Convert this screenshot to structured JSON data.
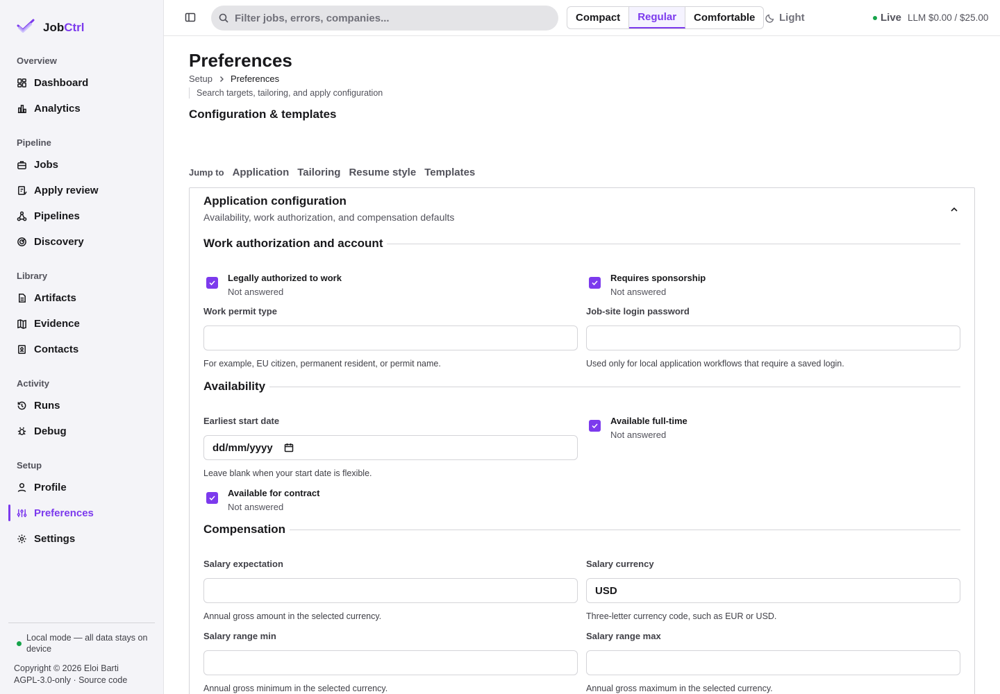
{
  "brand": {
    "name_prefix": "Job",
    "name_accent": "Ctrl"
  },
  "sidebar": {
    "sections": [
      {
        "title": "Overview",
        "items": [
          {
            "label": "Dashboard",
            "icon": "grid-icon"
          },
          {
            "label": "Analytics",
            "icon": "bar-chart-icon"
          }
        ]
      },
      {
        "title": "Pipeline",
        "items": [
          {
            "label": "Jobs",
            "icon": "briefcase-icon"
          },
          {
            "label": "Apply review",
            "icon": "clipboard-icon"
          },
          {
            "label": "Pipelines",
            "icon": "workflow-icon"
          },
          {
            "label": "Discovery",
            "icon": "radar-icon"
          }
        ]
      },
      {
        "title": "Library",
        "items": [
          {
            "label": "Artifacts",
            "icon": "file-icon"
          },
          {
            "label": "Evidence",
            "icon": "map-icon"
          },
          {
            "label": "Contacts",
            "icon": "contact-book-icon"
          }
        ]
      },
      {
        "title": "Activity",
        "items": [
          {
            "label": "Runs",
            "icon": "history-icon"
          },
          {
            "label": "Debug",
            "icon": "bug-icon"
          }
        ]
      },
      {
        "title": "Setup",
        "items": [
          {
            "label": "Profile",
            "icon": "user-icon"
          },
          {
            "label": "Preferences",
            "icon": "sliders-icon",
            "active": true
          },
          {
            "label": "Settings",
            "icon": "gear-icon"
          }
        ]
      }
    ],
    "local_mode": "Local mode — all data stays on device",
    "copyright": "Copyright © 2026 Eloi Barti",
    "license": "AGPL-3.0-only · Source code"
  },
  "topbar": {
    "search_placeholder": "Filter jobs, errors, companies...",
    "density": [
      "Compact",
      "Regular",
      "Comfortable"
    ],
    "density_selected": "Regular",
    "theme": "Light",
    "live": "Live",
    "llm_budget": "LLM $0.00 / $25.00",
    "accent_color": "#7c3aed"
  },
  "page": {
    "title": "Preferences",
    "breadcrumb": [
      "Setup",
      "Preferences"
    ],
    "subtitle": "Search targets, tailoring, and apply configuration",
    "section": "Configuration & templates",
    "jump_label": "Jump to",
    "jump_links": [
      "Application",
      "Tailoring",
      "Resume style",
      "Templates"
    ]
  },
  "card": {
    "title": "Application configuration",
    "subtitle": "Availability, work authorization, and compensation defaults",
    "groups": {
      "work_auth": "Work authorization and account",
      "availability": "Availability",
      "compensation": "Compensation"
    },
    "checks": {
      "authorized": {
        "label": "Legally authorized to work",
        "status": "Not answered"
      },
      "sponsorship": {
        "label": "Requires sponsorship",
        "status": "Not answered"
      },
      "full_time": {
        "label": "Available full-time",
        "status": "Not answered"
      },
      "contract": {
        "label": "Available for contract",
        "status": "Not answered"
      }
    },
    "fields": {
      "permit": {
        "label": "Work permit type",
        "value": "",
        "hint": "For example, EU citizen, permanent resident, or permit name."
      },
      "password": {
        "label": "Job-site login password",
        "value": "",
        "hint": "Used only for local application workflows that require a saved login."
      },
      "start_date": {
        "label": "Earliest start date",
        "value": "dd/mm/yyyy",
        "hint": "Leave blank when your start date is flexible."
      },
      "salary": {
        "label": "Salary expectation",
        "value": "",
        "hint": "Annual gross amount in the selected currency."
      },
      "currency": {
        "label": "Salary currency",
        "value": "USD",
        "hint": "Three-letter currency code, such as EUR or USD."
      },
      "range_min": {
        "label": "Salary range min",
        "value": "",
        "hint": "Annual gross minimum in the selected currency."
      },
      "range_max": {
        "label": "Salary range max",
        "value": "",
        "hint": "Annual gross maximum in the selected currency."
      }
    }
  }
}
